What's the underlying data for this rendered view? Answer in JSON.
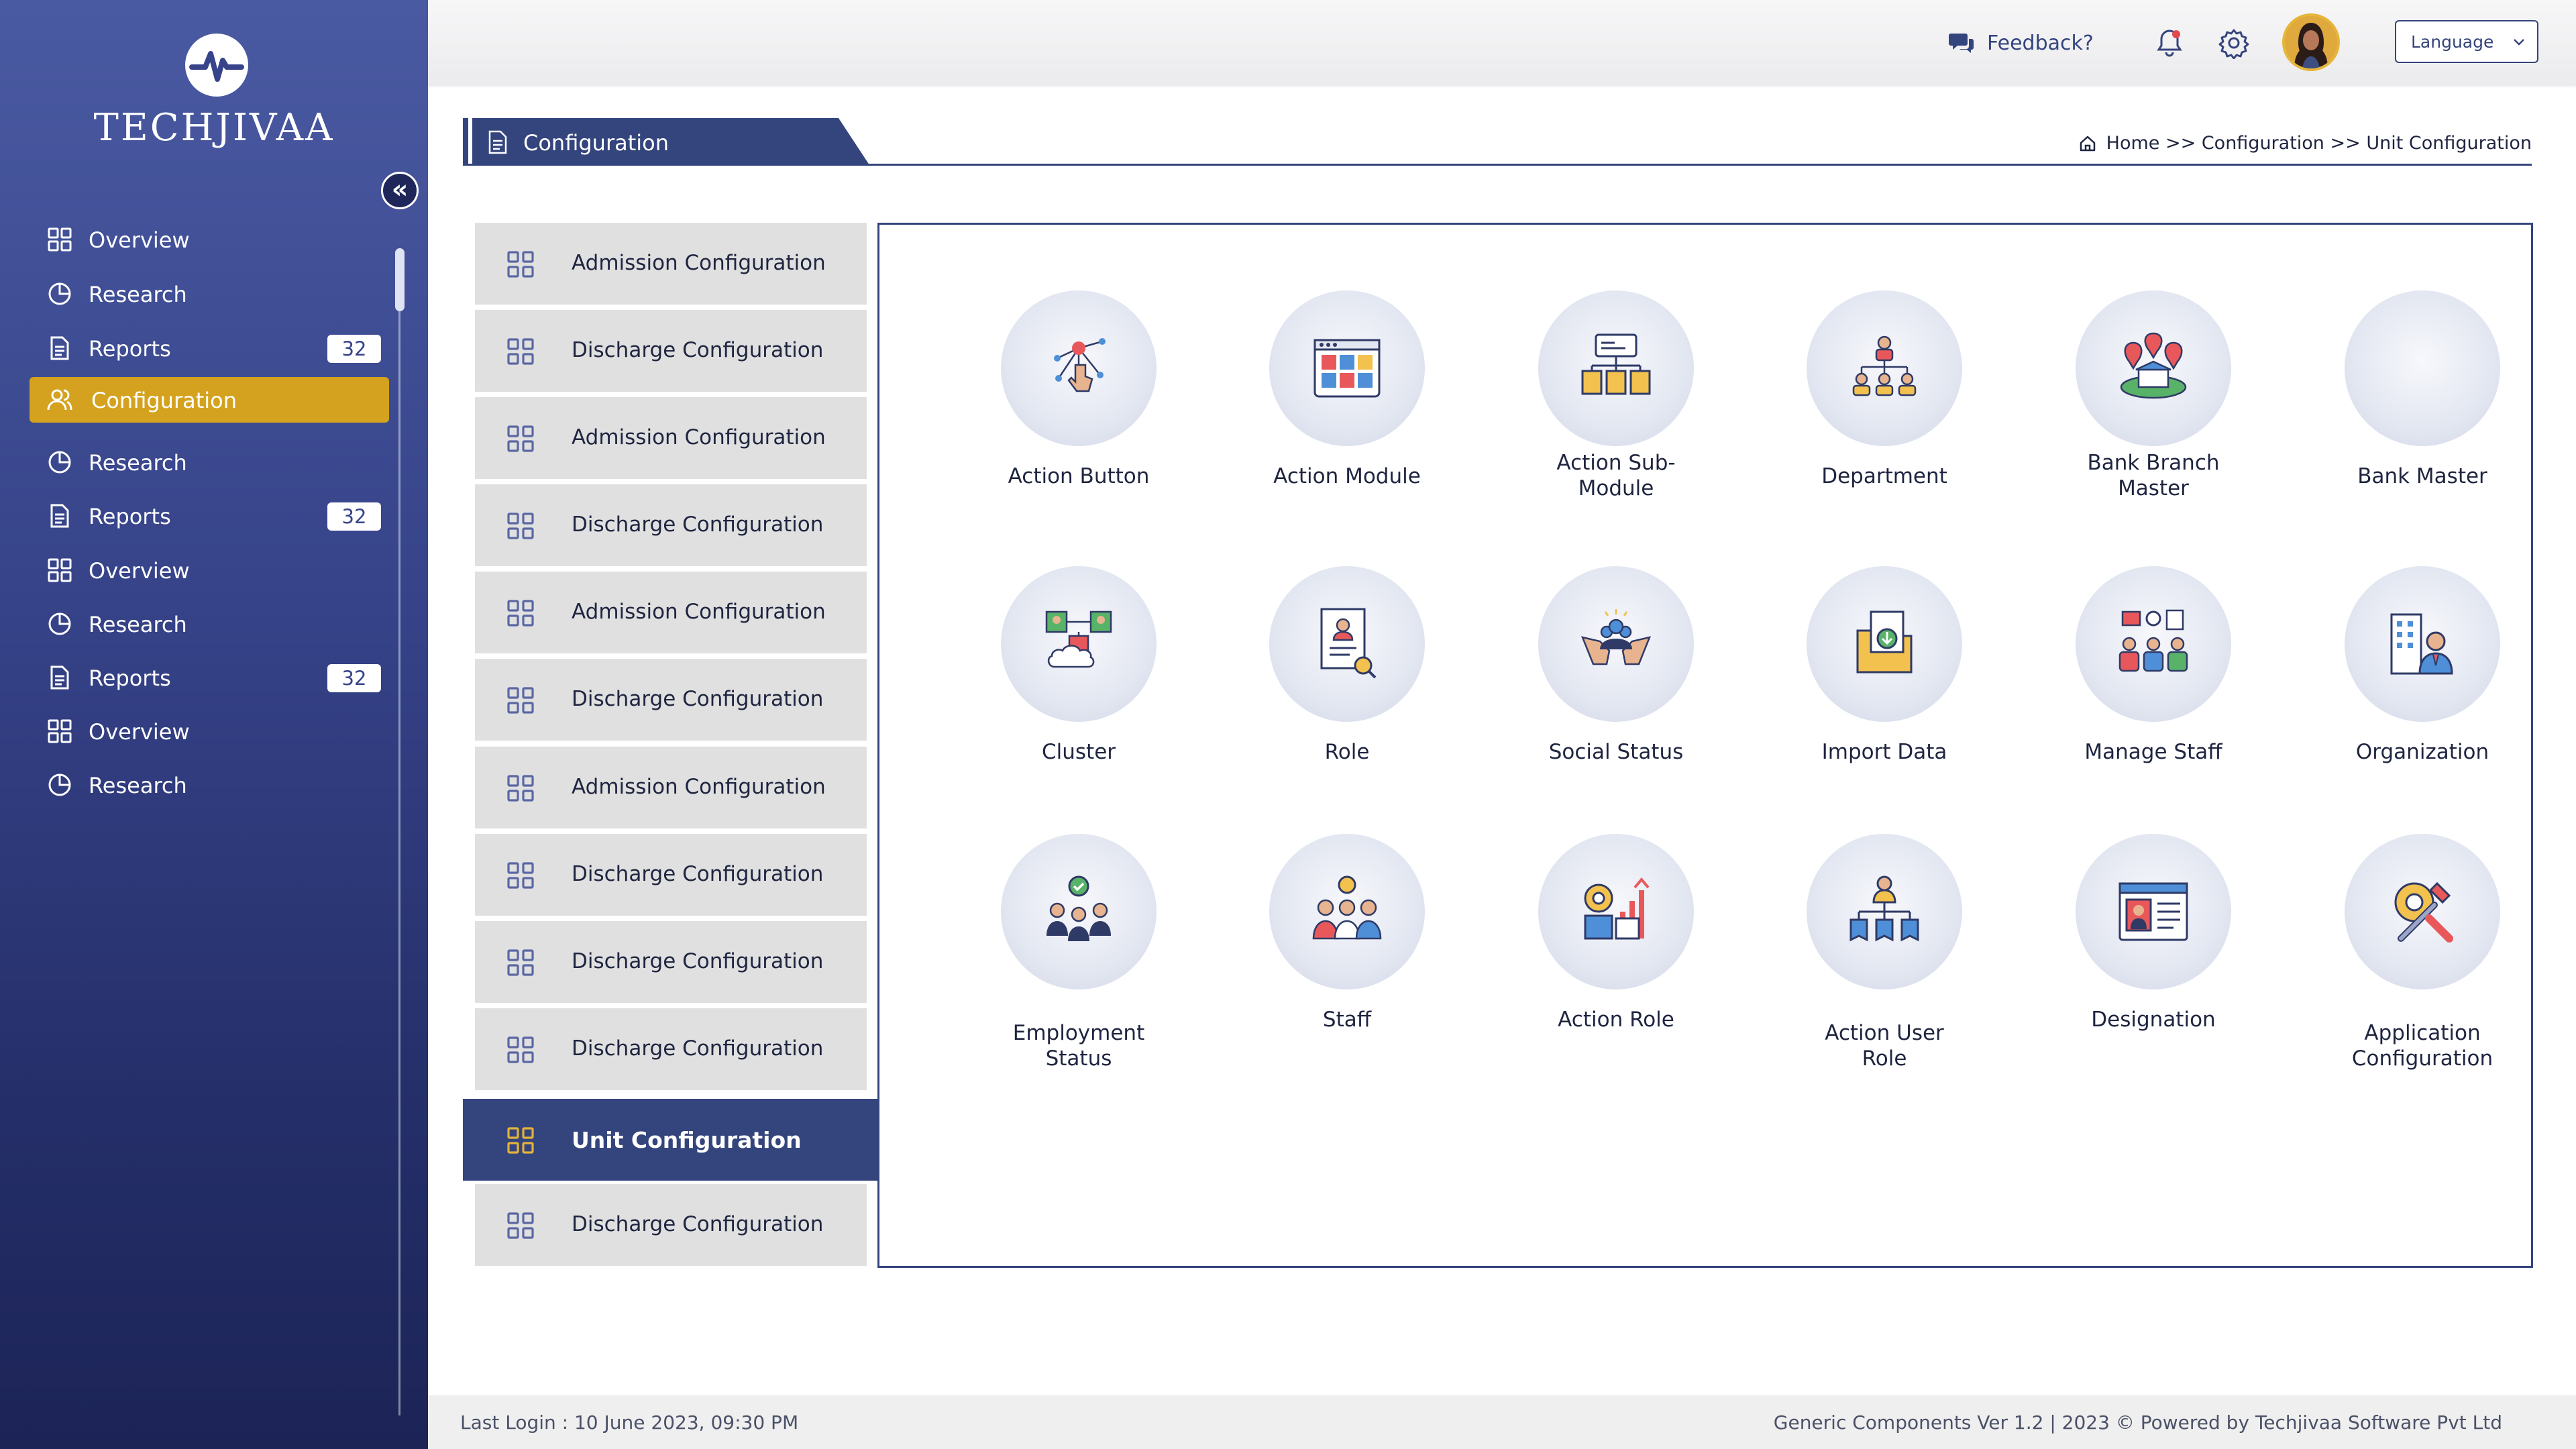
{
  "brand": {
    "name": "TECHJIVAA"
  },
  "sidebar": {
    "items": [
      {
        "label": "Overview",
        "icon": "grid-icon"
      },
      {
        "label": "Research",
        "icon": "pie-chart-icon"
      },
      {
        "label": "Reports",
        "icon": "document-icon",
        "badge": "32"
      },
      {
        "label": "Configuration",
        "icon": "users-icon",
        "active": true
      },
      {
        "label": "Research",
        "icon": "pie-chart-icon"
      },
      {
        "label": "Reports",
        "icon": "document-icon",
        "badge": "32"
      },
      {
        "label": "Overview",
        "icon": "grid-icon"
      },
      {
        "label": "Research",
        "icon": "pie-chart-icon"
      },
      {
        "label": "Reports",
        "icon": "document-icon",
        "badge": "32"
      },
      {
        "label": "Overview",
        "icon": "grid-icon"
      },
      {
        "label": "Research",
        "icon": "pie-chart-icon"
      }
    ]
  },
  "topbar": {
    "feedback_label": "Feedback?",
    "language_label": "Language"
  },
  "page": {
    "tab_title": "Configuration",
    "breadcrumb": "Home >> Configuration >> Unit Configuration"
  },
  "config_menu": [
    {
      "label": "Admission Configuration"
    },
    {
      "label": "Discharge Configuration"
    },
    {
      "label": "Admission Configuration"
    },
    {
      "label": "Discharge Configuration"
    },
    {
      "label": "Admission Configuration"
    },
    {
      "label": "Discharge Configuration"
    },
    {
      "label": "Admission Configuration"
    },
    {
      "label": "Discharge Configuration"
    },
    {
      "label": "Discharge Configuration"
    },
    {
      "label": "Discharge Configuration"
    },
    {
      "label": "Unit Configuration",
      "active": true
    },
    {
      "label": "Discharge Configuration"
    }
  ],
  "tiles": [
    {
      "label": "Action Button",
      "icon": "touch-network-icon"
    },
    {
      "label": "Action Module",
      "icon": "module-window-icon"
    },
    {
      "label": "Action Sub-Module",
      "icon": "sub-module-folders-icon"
    },
    {
      "label": "Department",
      "icon": "department-hierarchy-icon"
    },
    {
      "label": "Bank Branch Master",
      "icon": "bank-branch-map-icon"
    },
    {
      "label": "Bank Master",
      "icon": ""
    },
    {
      "label": "Cluster",
      "icon": "cluster-people-cloud-icon"
    },
    {
      "label": "Role",
      "icon": "role-document-icon"
    },
    {
      "label": "Social Status",
      "icon": "social-hands-icon"
    },
    {
      "label": "Import Data",
      "icon": "import-data-icon"
    },
    {
      "label": "Manage Staff",
      "icon": "manage-staff-icon"
    },
    {
      "label": "Organization",
      "icon": "organization-building-icon"
    },
    {
      "label": "Employment Status",
      "icon": "employment-status-icon"
    },
    {
      "label": "Staff",
      "icon": "staff-group-icon"
    },
    {
      "label": "Action Role",
      "icon": "action-role-icon"
    },
    {
      "label": "Action User Role",
      "icon": "user-role-tree-icon"
    },
    {
      "label": "Designation",
      "icon": "designation-card-icon"
    },
    {
      "label": "Application Configuration",
      "icon": "tools-gear-icon"
    }
  ],
  "footer": {
    "last_login": "Last Login : 10 June 2023, 09:30 PM",
    "copyright": "Generic Components Ver 1.2   |   2023 © Powered by Techjivaa Software Pvt Ltd"
  },
  "colors": {
    "sidebar_top": "#4a5aa2",
    "sidebar_bottom": "#1c2456",
    "accent_gold": "#d4a21e",
    "navy": "#34447c",
    "menu_gray": "#e0e0e0"
  }
}
